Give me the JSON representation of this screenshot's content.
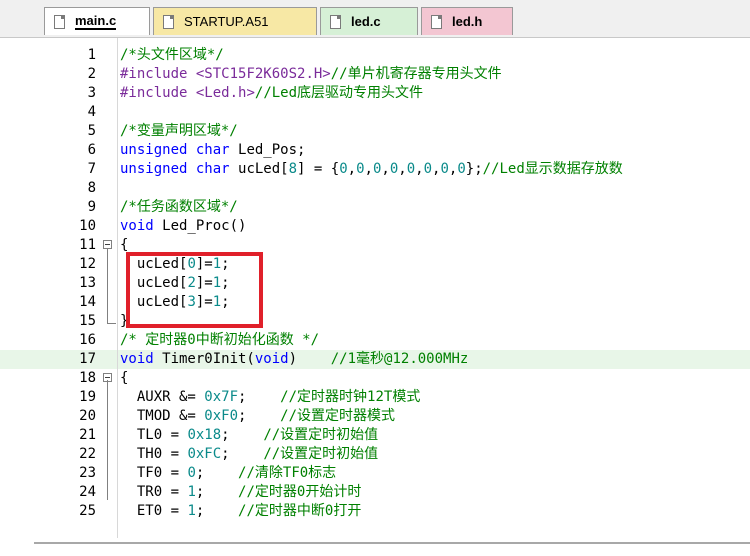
{
  "tabs": [
    {
      "label": "main.c",
      "active": true
    },
    {
      "label": "STARTUP.A51",
      "active": false
    },
    {
      "label": "led.c",
      "active": false
    },
    {
      "label": "led.h",
      "active": false
    }
  ],
  "lines": [
    {
      "n": "1",
      "code": "/*头文件区域*/"
    },
    {
      "n": "2",
      "code": "#include <STC15F2K60S2.H>//单片机寄存器专用头文件"
    },
    {
      "n": "3",
      "code": "#include <Led.h>//Led底层驱动专用头文件"
    },
    {
      "n": "4",
      "code": ""
    },
    {
      "n": "5",
      "code": "/*变量声明区域*/"
    },
    {
      "n": "6",
      "code": "unsigned char Led_Pos;"
    },
    {
      "n": "7",
      "code": "unsigned char ucLed[8] = {0,0,0,0,0,0,0,0};//Led显示数据存放数"
    },
    {
      "n": "8",
      "code": ""
    },
    {
      "n": "9",
      "code": "/*任务函数区域*/"
    },
    {
      "n": "10",
      "code": "void Led_Proc()"
    },
    {
      "n": "11",
      "code": "{"
    },
    {
      "n": "12",
      "code": "  ucLed[0]=1;"
    },
    {
      "n": "13",
      "code": "  ucLed[2]=1;"
    },
    {
      "n": "14",
      "code": "  ucLed[3]=1;"
    },
    {
      "n": "15",
      "code": "}"
    },
    {
      "n": "16",
      "code": "/* 定时器0中断初始化函数 */"
    },
    {
      "n": "17",
      "code": "void Timer0Init(void)    //1毫秒@12.000MHz"
    },
    {
      "n": "18",
      "code": "{"
    },
    {
      "n": "19",
      "code": "  AUXR &= 0x7F;    //定时器时钟12T模式"
    },
    {
      "n": "20",
      "code": "  TMOD &= 0xF0;    //设置定时器模式"
    },
    {
      "n": "21",
      "code": "  TL0 = 0x18;    //设置定时初始值"
    },
    {
      "n": "22",
      "code": "  TH0 = 0xFC;    //设置定时初始值"
    },
    {
      "n": "23",
      "code": "  TF0 = 0;    //清除TF0标志"
    },
    {
      "n": "24",
      "code": "  TR0 = 1;    //定时器0开始计时"
    },
    {
      "n": "25",
      "code": "  ET0 = 1;    //定时器中断0打开"
    }
  ],
  "highlighted_line": "17",
  "annotation": {
    "color": "#e0202a",
    "covers_lines": [
      "12",
      "13",
      "14"
    ]
  }
}
